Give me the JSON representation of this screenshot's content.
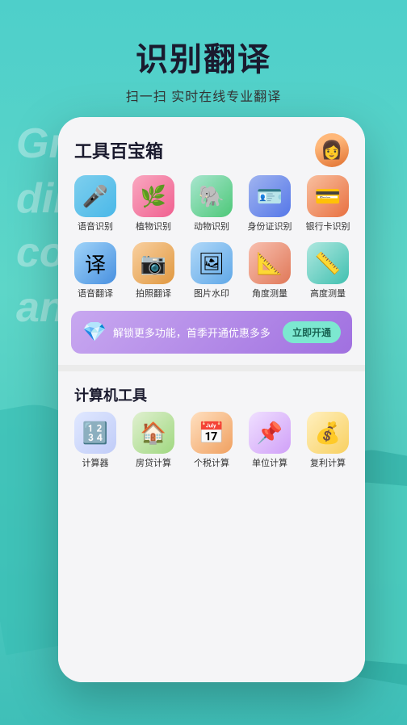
{
  "header": {
    "main_title": "识别翻译",
    "sub_title": "扫一扫 实时在线专业翻译"
  },
  "bg_text": {
    "line1": "Growth is the",
    "line2": "dil",
    "line3": "co",
    "line4": "an"
  },
  "card": {
    "title": "工具百宝箱",
    "avatar_emoji": "👩"
  },
  "tools": [
    {
      "id": "voice",
      "label": "语音识别",
      "icon": "🎤",
      "class": "icon-voice"
    },
    {
      "id": "plant",
      "label": "植物识别",
      "icon": "🌿",
      "class": "icon-plant"
    },
    {
      "id": "animal",
      "label": "动物识别",
      "icon": "🐘",
      "class": "icon-animal"
    },
    {
      "id": "idcard",
      "label": "身份证识别",
      "icon": "🪪",
      "class": "icon-id"
    },
    {
      "id": "bankcard",
      "label": "银行卡识别",
      "icon": "💳",
      "class": "icon-bankcard"
    },
    {
      "id": "translate",
      "label": "语音翻译",
      "icon": "译",
      "class": "icon-translate"
    },
    {
      "id": "photo",
      "label": "拍照翻译",
      "icon": "📷",
      "class": "icon-photo"
    },
    {
      "id": "watermark",
      "label": "图片水印",
      "icon": "🖼",
      "class": "icon-watermark"
    },
    {
      "id": "angle",
      "label": "角度测量",
      "icon": "📐",
      "class": "icon-angle"
    },
    {
      "id": "height",
      "label": "高度测量",
      "icon": "📏",
      "class": "icon-height"
    }
  ],
  "banner": {
    "text": "解锁更多功能，首季开通优惠多多",
    "button": "立即开通"
  },
  "calc_section": {
    "title": "计算机工具"
  },
  "calc_tools": [
    {
      "id": "calc",
      "label": "计算器",
      "icon": "🔢",
      "class": "icon-calc"
    },
    {
      "id": "loan",
      "label": "房贷计算",
      "icon": "🏠",
      "class": "icon-loan"
    },
    {
      "id": "tax",
      "label": "个税计算",
      "icon": "📅",
      "class": "icon-tax"
    },
    {
      "id": "unit",
      "label": "单位计算",
      "icon": "📌",
      "class": "icon-unit"
    },
    {
      "id": "compound",
      "label": "复利计算",
      "icon": "💰",
      "class": "icon-compound"
    }
  ]
}
